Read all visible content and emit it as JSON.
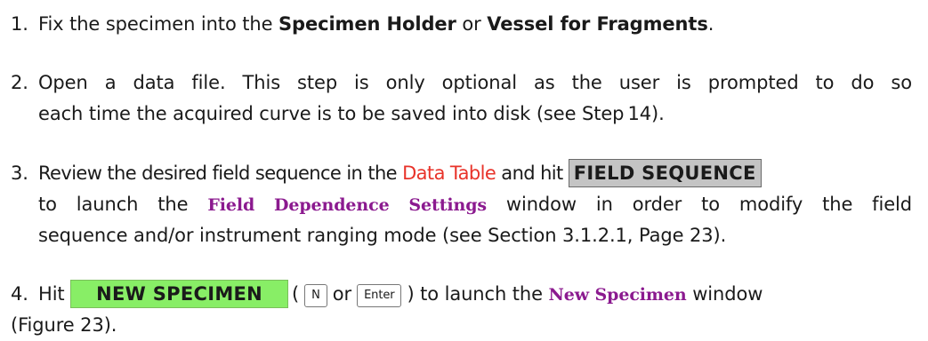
{
  "steps": [
    {
      "number": "1.",
      "text_a": "Fix the specimen into the ",
      "bold_a": "Specimen Holder",
      "text_b": " or ",
      "bold_b": "Vessel for Fragments",
      "text_c": "."
    },
    {
      "number": "2.",
      "line1": "Open a data file. This step is only optional as the user is prompted to do so",
      "line2": "each time the acquired curve is to be saved into disk (see Step 14)."
    },
    {
      "number": "3.",
      "text_a": "Review the desired field sequence in the ",
      "link_a": "Data Table",
      "text_b": " and hit ",
      "button": "FIELD SEQUENCE",
      "text_c": "to launch the ",
      "window_name": "Field Dependence Settings",
      "text_d": " window in order to modify the field",
      "line3": "sequence and/or instrument ranging mode (see Section 3.1.2.1, Page 23)."
    },
    {
      "number": "4.",
      "text_a": "Hit ",
      "button": "NEW SPECIMEN",
      "paren_open": "(",
      "key1": "N",
      "or": "or",
      "key2": "Enter",
      "paren_close": ") to launch the ",
      "window_name": "New Specimen",
      "text_b": " window",
      "line2": "(Figure 23)."
    }
  ],
  "colors": {
    "link_red": "#e8332a",
    "window_purple": "#8b1a8f",
    "grey_button": "#c4c4c4",
    "green_button": "#88ee66"
  }
}
